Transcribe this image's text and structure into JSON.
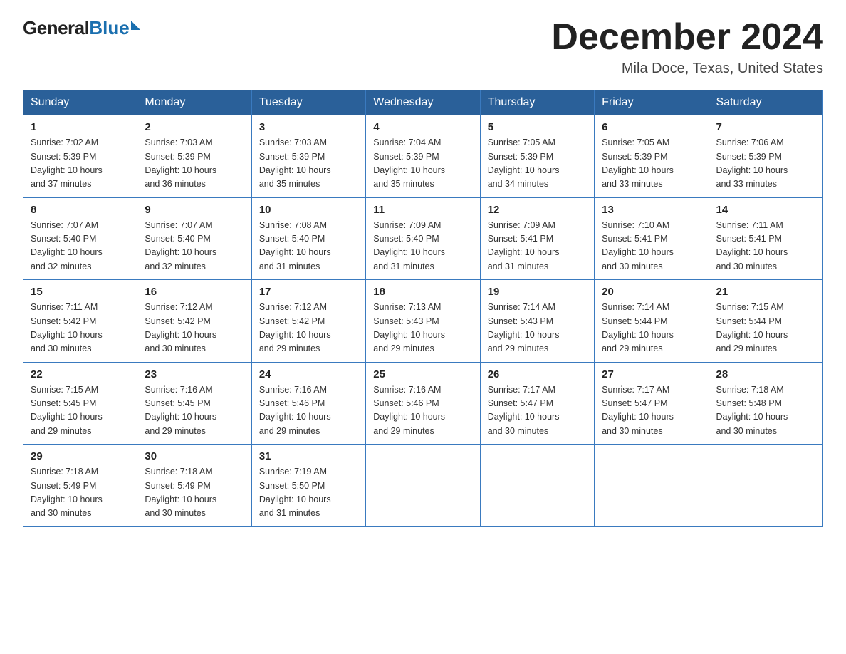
{
  "logo": {
    "general": "General",
    "blue": "Blue"
  },
  "header": {
    "title": "December 2024",
    "location": "Mila Doce, Texas, United States"
  },
  "days_of_week": [
    "Sunday",
    "Monday",
    "Tuesday",
    "Wednesday",
    "Thursday",
    "Friday",
    "Saturday"
  ],
  "weeks": [
    [
      {
        "day": "1",
        "sunrise": "7:02 AM",
        "sunset": "5:39 PM",
        "daylight": "10 hours and 37 minutes."
      },
      {
        "day": "2",
        "sunrise": "7:03 AM",
        "sunset": "5:39 PM",
        "daylight": "10 hours and 36 minutes."
      },
      {
        "day": "3",
        "sunrise": "7:03 AM",
        "sunset": "5:39 PM",
        "daylight": "10 hours and 35 minutes."
      },
      {
        "day": "4",
        "sunrise": "7:04 AM",
        "sunset": "5:39 PM",
        "daylight": "10 hours and 35 minutes."
      },
      {
        "day": "5",
        "sunrise": "7:05 AM",
        "sunset": "5:39 PM",
        "daylight": "10 hours and 34 minutes."
      },
      {
        "day": "6",
        "sunrise": "7:05 AM",
        "sunset": "5:39 PM",
        "daylight": "10 hours and 33 minutes."
      },
      {
        "day": "7",
        "sunrise": "7:06 AM",
        "sunset": "5:39 PM",
        "daylight": "10 hours and 33 minutes."
      }
    ],
    [
      {
        "day": "8",
        "sunrise": "7:07 AM",
        "sunset": "5:40 PM",
        "daylight": "10 hours and 32 minutes."
      },
      {
        "day": "9",
        "sunrise": "7:07 AM",
        "sunset": "5:40 PM",
        "daylight": "10 hours and 32 minutes."
      },
      {
        "day": "10",
        "sunrise": "7:08 AM",
        "sunset": "5:40 PM",
        "daylight": "10 hours and 31 minutes."
      },
      {
        "day": "11",
        "sunrise": "7:09 AM",
        "sunset": "5:40 PM",
        "daylight": "10 hours and 31 minutes."
      },
      {
        "day": "12",
        "sunrise": "7:09 AM",
        "sunset": "5:41 PM",
        "daylight": "10 hours and 31 minutes."
      },
      {
        "day": "13",
        "sunrise": "7:10 AM",
        "sunset": "5:41 PM",
        "daylight": "10 hours and 30 minutes."
      },
      {
        "day": "14",
        "sunrise": "7:11 AM",
        "sunset": "5:41 PM",
        "daylight": "10 hours and 30 minutes."
      }
    ],
    [
      {
        "day": "15",
        "sunrise": "7:11 AM",
        "sunset": "5:42 PM",
        "daylight": "10 hours and 30 minutes."
      },
      {
        "day": "16",
        "sunrise": "7:12 AM",
        "sunset": "5:42 PM",
        "daylight": "10 hours and 30 minutes."
      },
      {
        "day": "17",
        "sunrise": "7:12 AM",
        "sunset": "5:42 PM",
        "daylight": "10 hours and 29 minutes."
      },
      {
        "day": "18",
        "sunrise": "7:13 AM",
        "sunset": "5:43 PM",
        "daylight": "10 hours and 29 minutes."
      },
      {
        "day": "19",
        "sunrise": "7:14 AM",
        "sunset": "5:43 PM",
        "daylight": "10 hours and 29 minutes."
      },
      {
        "day": "20",
        "sunrise": "7:14 AM",
        "sunset": "5:44 PM",
        "daylight": "10 hours and 29 minutes."
      },
      {
        "day": "21",
        "sunrise": "7:15 AM",
        "sunset": "5:44 PM",
        "daylight": "10 hours and 29 minutes."
      }
    ],
    [
      {
        "day": "22",
        "sunrise": "7:15 AM",
        "sunset": "5:45 PM",
        "daylight": "10 hours and 29 minutes."
      },
      {
        "day": "23",
        "sunrise": "7:16 AM",
        "sunset": "5:45 PM",
        "daylight": "10 hours and 29 minutes."
      },
      {
        "day": "24",
        "sunrise": "7:16 AM",
        "sunset": "5:46 PM",
        "daylight": "10 hours and 29 minutes."
      },
      {
        "day": "25",
        "sunrise": "7:16 AM",
        "sunset": "5:46 PM",
        "daylight": "10 hours and 29 minutes."
      },
      {
        "day": "26",
        "sunrise": "7:17 AM",
        "sunset": "5:47 PM",
        "daylight": "10 hours and 30 minutes."
      },
      {
        "day": "27",
        "sunrise": "7:17 AM",
        "sunset": "5:47 PM",
        "daylight": "10 hours and 30 minutes."
      },
      {
        "day": "28",
        "sunrise": "7:18 AM",
        "sunset": "5:48 PM",
        "daylight": "10 hours and 30 minutes."
      }
    ],
    [
      {
        "day": "29",
        "sunrise": "7:18 AM",
        "sunset": "5:49 PM",
        "daylight": "10 hours and 30 minutes."
      },
      {
        "day": "30",
        "sunrise": "7:18 AM",
        "sunset": "5:49 PM",
        "daylight": "10 hours and 30 minutes."
      },
      {
        "day": "31",
        "sunrise": "7:19 AM",
        "sunset": "5:50 PM",
        "daylight": "10 hours and 31 minutes."
      },
      null,
      null,
      null,
      null
    ]
  ],
  "labels": {
    "sunrise": "Sunrise:",
    "sunset": "Sunset:",
    "daylight": "Daylight:"
  }
}
